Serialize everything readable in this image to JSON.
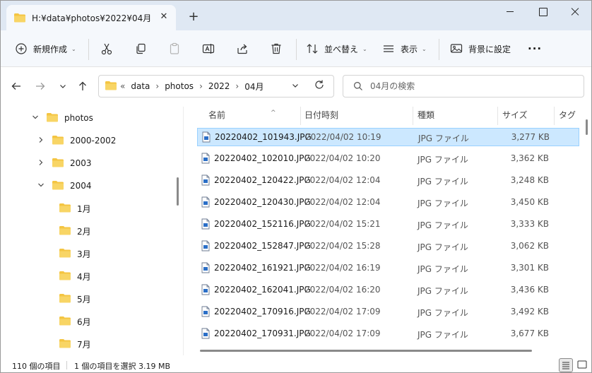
{
  "window": {
    "tab_title": "H:¥data¥photos¥2022¥04月",
    "tab_close_icon": "close-icon",
    "new_tab_icon": "plus-icon"
  },
  "toolbar": {
    "new_label": "新規作成",
    "sort_label": "並べ替え",
    "view_label": "表示",
    "background_label": "背景に設定",
    "more_label": "···"
  },
  "address": {
    "overflow": "«",
    "crumbs": [
      "data",
      "photos",
      "2022",
      "04月"
    ],
    "separator": "›"
  },
  "search": {
    "placeholder": "04月の検索"
  },
  "sidebar": {
    "items": [
      {
        "label": "photos",
        "arrow": "⌄"
      },
      {
        "label": "2000-2002",
        "arrow": "›"
      },
      {
        "label": "2003",
        "arrow": "›"
      },
      {
        "label": "2004",
        "arrow": "⌄"
      },
      {
        "label": "1月",
        "arrow": ""
      },
      {
        "label": "2月",
        "arrow": ""
      },
      {
        "label": "3月",
        "arrow": ""
      },
      {
        "label": "4月",
        "arrow": ""
      },
      {
        "label": "5月",
        "arrow": ""
      },
      {
        "label": "6月",
        "arrow": ""
      },
      {
        "label": "7月",
        "arrow": ""
      }
    ]
  },
  "files": {
    "columns": {
      "name": "名前",
      "date": "日付時刻",
      "type": "種類",
      "size": "サイズ",
      "tag": "タグ"
    },
    "sort_indicator": "^",
    "rows": [
      {
        "name": "20220402_101943.JPG",
        "date": "2022/04/02 10:19",
        "type": "JPG ファイル",
        "size": "3,277 KB",
        "selected": true
      },
      {
        "name": "20220402_102010.JPG",
        "date": "2022/04/02 10:20",
        "type": "JPG ファイル",
        "size": "3,362 KB"
      },
      {
        "name": "20220402_120422.JPG",
        "date": "2022/04/02 12:04",
        "type": "JPG ファイル",
        "size": "3,248 KB"
      },
      {
        "name": "20220402_120430.JPG",
        "date": "2022/04/02 12:04",
        "type": "JPG ファイル",
        "size": "3,450 KB"
      },
      {
        "name": "20220402_152116.JPG",
        "date": "2022/04/02 15:21",
        "type": "JPG ファイル",
        "size": "3,333 KB"
      },
      {
        "name": "20220402_152847.JPG",
        "date": "2022/04/02 15:28",
        "type": "JPG ファイル",
        "size": "3,062 KB"
      },
      {
        "name": "20220402_161921.JPG",
        "date": "2022/04/02 16:19",
        "type": "JPG ファイル",
        "size": "3,301 KB"
      },
      {
        "name": "20220402_162041.JPG",
        "date": "2022/04/02 16:20",
        "type": "JPG ファイル",
        "size": "3,436 KB"
      },
      {
        "name": "20220402_170916.JPG",
        "date": "2022/04/02 17:09",
        "type": "JPG ファイル",
        "size": "3,492 KB"
      },
      {
        "name": "20220402_170931.JPG",
        "date": "2022/04/02 17:09",
        "type": "JPG ファイル",
        "size": "3,677 KB"
      }
    ]
  },
  "status": {
    "item_count": "110 個の項目",
    "selection": "1 個の項目を選択  3.19 MB"
  },
  "colors": {
    "folder": "#f4c542",
    "selection_bg": "#cce8ff",
    "selection_border": "#99d1ff",
    "file_icon": "#2b6fc7"
  }
}
